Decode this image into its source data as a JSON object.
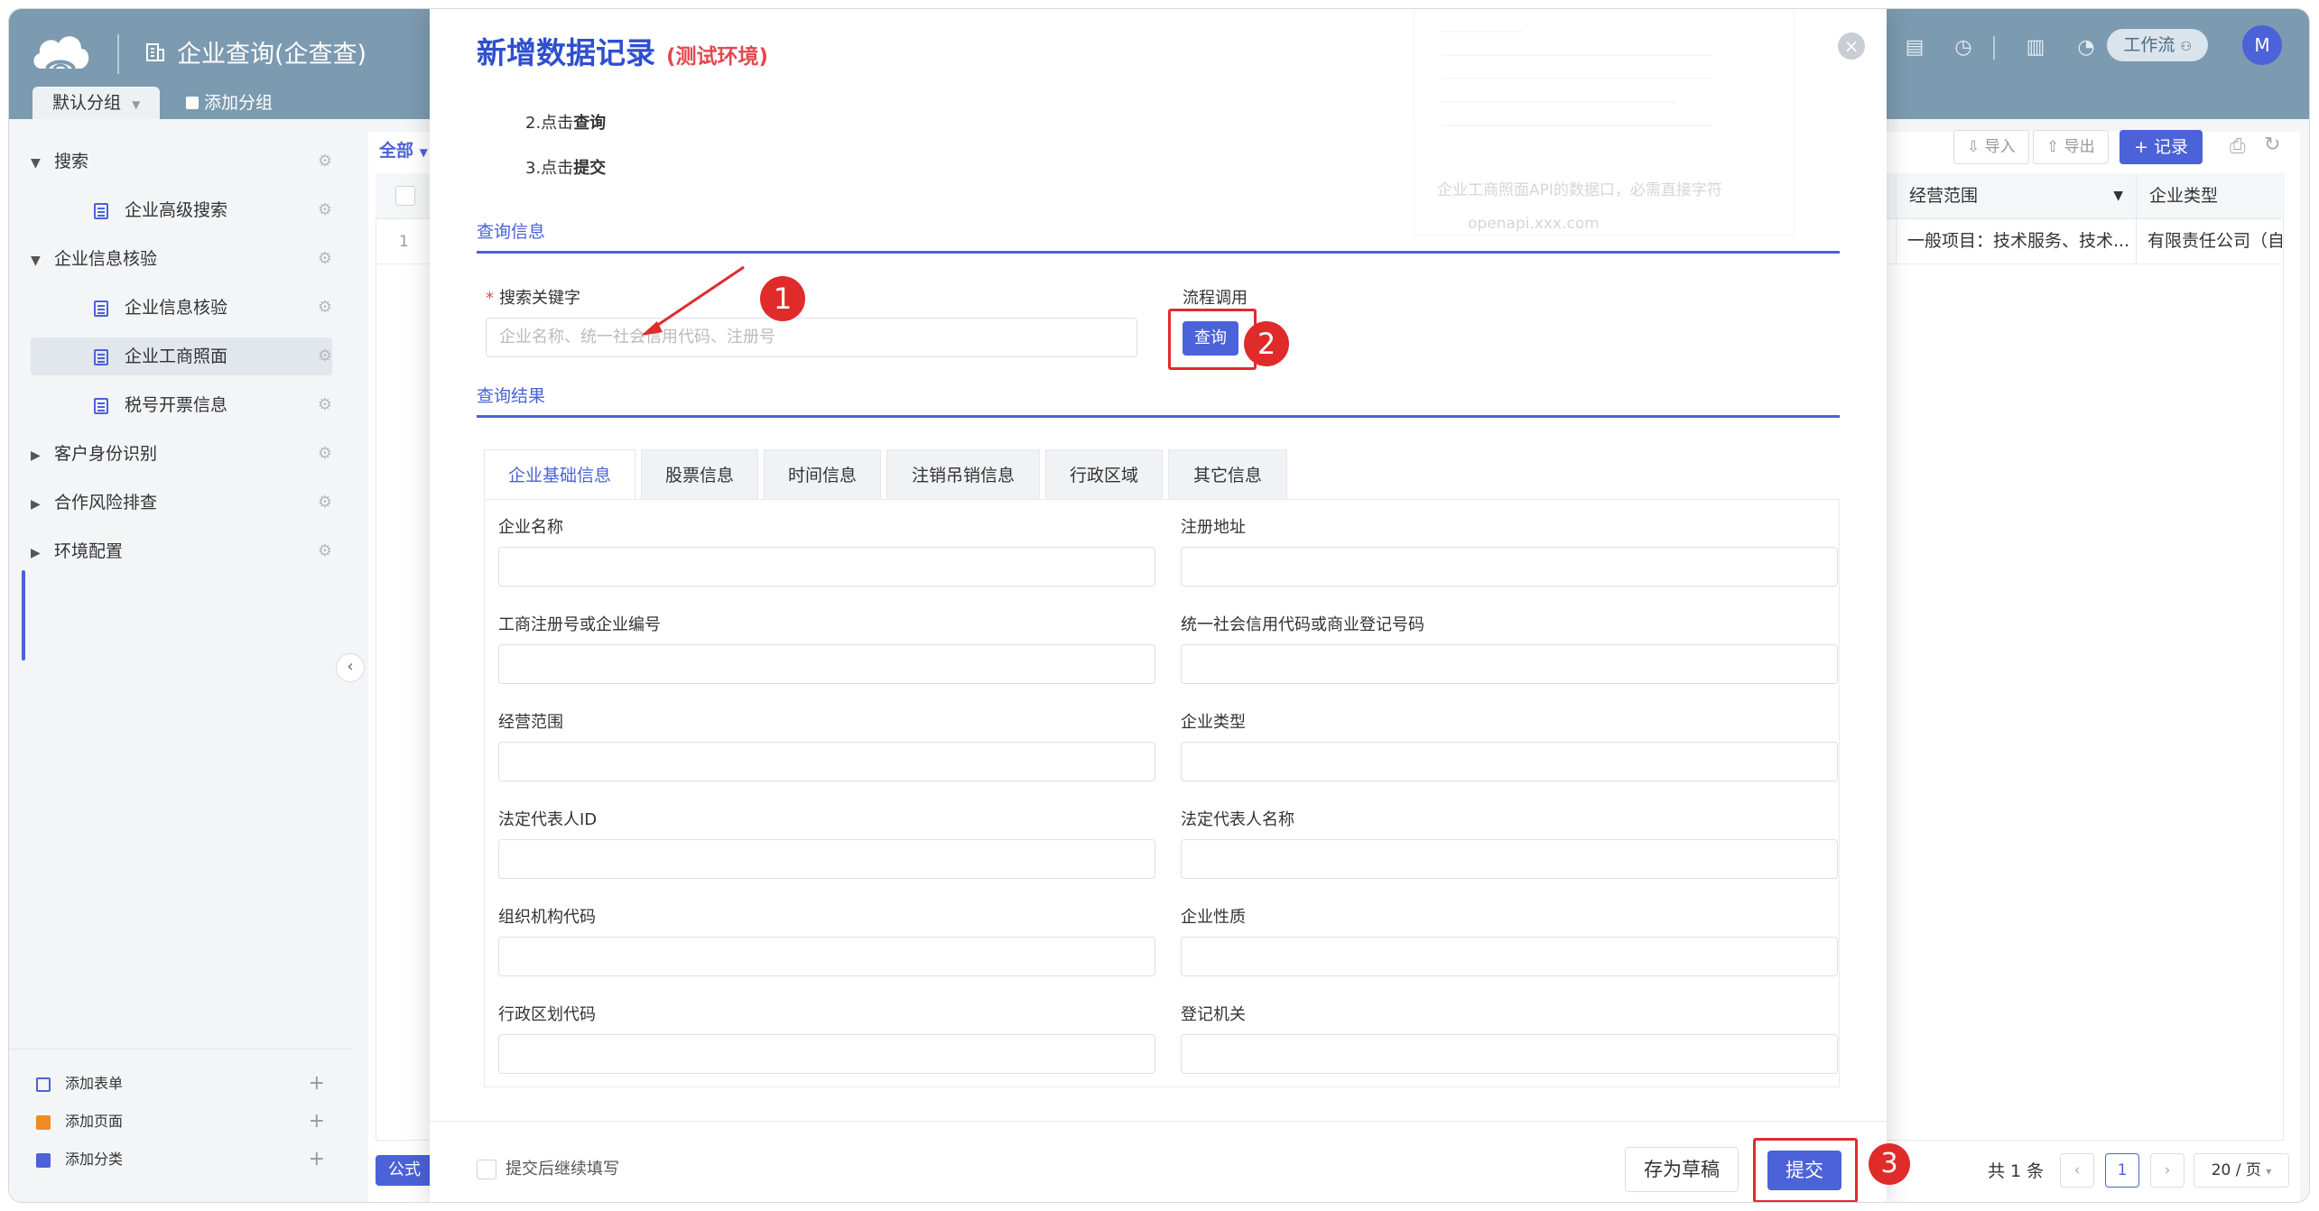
{
  "app": {
    "title": "企业查询(企查查)",
    "group_tab": "默认分组",
    "add_group": "添加分组",
    "workflow": "工作流",
    "avatar": "M"
  },
  "sidebar": {
    "items": [
      {
        "label": "搜索"
      },
      {
        "label": "企业高级搜索"
      },
      {
        "label": "企业信息核验"
      },
      {
        "label": "企业信息核验"
      },
      {
        "label": "企业工商照面"
      },
      {
        "label": "税号开票信息"
      },
      {
        "label": "客户身份识别"
      },
      {
        "label": "合作风险排查"
      },
      {
        "label": "环境配置"
      }
    ],
    "bottom": [
      {
        "label": "添加表单"
      },
      {
        "label": "添加页面"
      },
      {
        "label": "添加分类"
      }
    ]
  },
  "background": {
    "filter": "全部",
    "import": "导入",
    "export": "导出",
    "record": "+ 记录",
    "columns": [
      "经营范围",
      "企业类型"
    ],
    "row": {
      "no": "1",
      "scope": "一般项目：技术服务、技术...",
      "type": "有限责任公司（自"
    },
    "formula": "公式",
    "total": "共 1 条",
    "page": "1",
    "page_size": "20 / 页"
  },
  "modal": {
    "title": "新增数据记录",
    "env": "(测试环境)",
    "steps": [
      {
        "prefix": "2.点击",
        "action": "查询"
      },
      {
        "prefix": "3.点击",
        "action": "提交"
      }
    ],
    "ghost_text_1": "企业工商照面API的数据口，必需直接字符",
    "ghost_text_2": "openapi.xxx.com",
    "section_query": "查询信息",
    "keyword_label": "搜索关键字",
    "keyword_placeholder": "企业名称、统一社会信用代码、注册号",
    "flow_label": "流程调用",
    "query_button": "查询",
    "section_result": "查询结果",
    "tabs": [
      "企业基础信息",
      "股票信息",
      "时间信息",
      "注销吊销信息",
      "行政区域",
      "其它信息"
    ],
    "fields": [
      {
        "left": "企业名称",
        "right": "注册地址"
      },
      {
        "left": "工商注册号或企业编号",
        "right": "统一社会信用代码或商业登记号码"
      },
      {
        "left": "经营范围",
        "right": "企业类型"
      },
      {
        "left": "法定代表人ID",
        "right": "法定代表人名称"
      },
      {
        "left": "组织机构代码",
        "right": "企业性质"
      },
      {
        "left": "行政区划代码",
        "right": "登记机关"
      }
    ],
    "continue_label": "提交后继续填写",
    "draft_button": "存为草稿",
    "submit_button": "提交",
    "badges": [
      "1",
      "2",
      "3"
    ]
  },
  "colors": {
    "primary": "#4b62d8",
    "header": "#7c9ab0",
    "callout": "#e02b2b",
    "env": "#e5484d"
  },
  "icons": [
    "cloud-logo-icon",
    "building-icon",
    "gear-icon",
    "doc-icon",
    "close-icon",
    "history-icon",
    "clipboard-icon",
    "bell-icon",
    "chevron-left-icon",
    "arrow-icon"
  ]
}
